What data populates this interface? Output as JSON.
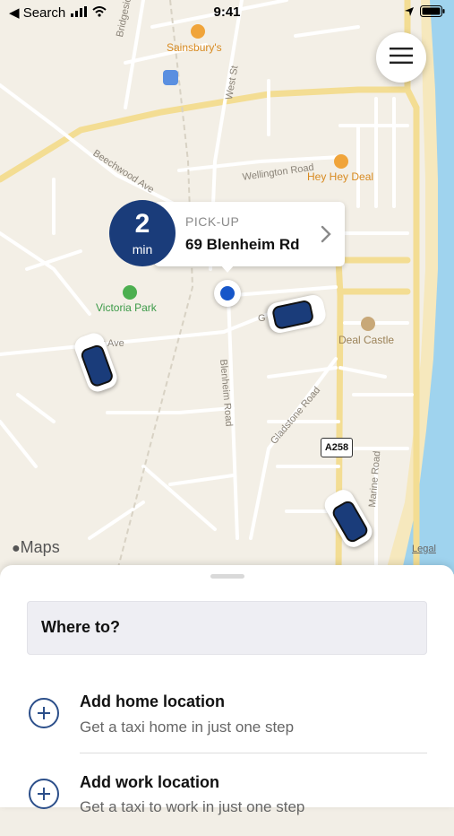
{
  "status_bar": {
    "back_label": "◀ Search",
    "time": "9:41"
  },
  "map": {
    "streets": [
      "Bridgeside",
      "West St",
      "Beechwood Ave",
      "Wellington Road",
      "Blenheim Road",
      "Gladstone Road",
      "Marine Road",
      "k Ave",
      "G"
    ],
    "pois": {
      "sainsburys": "Sainsbury's",
      "hey_hey_deal": "Hey Hey Deal",
      "victoria_park": "Victoria Park",
      "deal_castle": "Deal Castle"
    },
    "road_sign": "A258",
    "attribution": "Maps",
    "legal": "Legal"
  },
  "pickup": {
    "eta_number": "2",
    "eta_unit": "min",
    "label": "PICK-UP",
    "address": "69 Blenheim Rd"
  },
  "sheet": {
    "search_placeholder": "Where to?",
    "home": {
      "title": "Add home location",
      "subtitle": "Get a taxi home in just one step"
    },
    "work": {
      "title": "Add work location",
      "subtitle": "Get a taxi to work in just one step"
    }
  },
  "colors": {
    "accent": "#1a3c7a",
    "sea": "#9fd3ee",
    "beach": "#f5e6b8",
    "main_road": "#f7e6a8"
  }
}
